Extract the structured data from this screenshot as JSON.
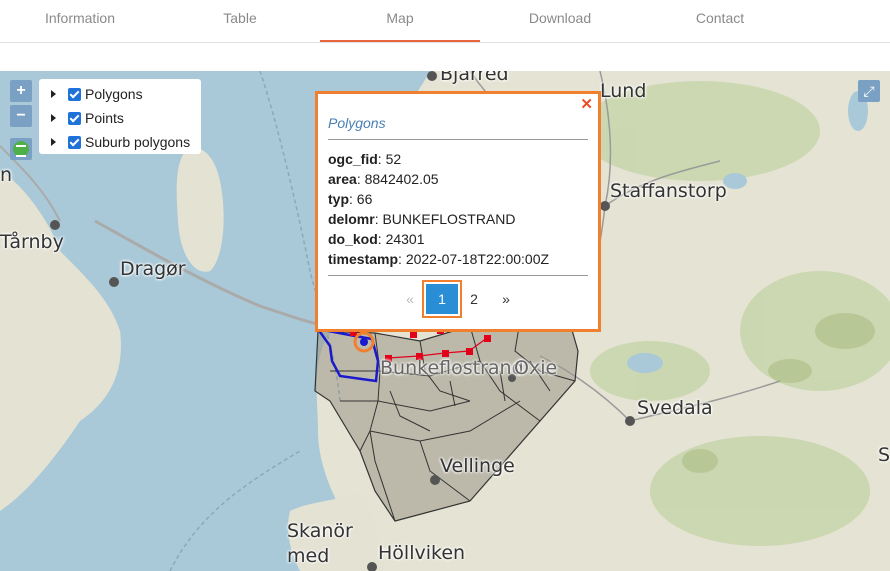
{
  "tabs": [
    "Information",
    "Table",
    "Map",
    "Download",
    "Contact"
  ],
  "active_tab": "Map",
  "map": {
    "places": [
      "Bjärred",
      "Lund",
      "Staffanstorp",
      "Tårnby",
      "Dragør",
      "Svedala",
      "Vellinge",
      "Bunkeflostrand",
      "Oxie",
      "Skanör",
      "med",
      "Höllviken",
      "n",
      "S"
    ],
    "zoom_in": "+",
    "zoom_out": "−",
    "fullscreen": "⤢"
  },
  "layers": [
    {
      "label": "Polygons",
      "checked": true
    },
    {
      "label": "Points",
      "checked": true
    },
    {
      "label": "Suburb polygons",
      "checked": true
    }
  ],
  "popup": {
    "title": "Polygons",
    "close": "✕",
    "fields": [
      {
        "key": "ogc_fid",
        "value": "52"
      },
      {
        "key": "area",
        "value": "8842402.05"
      },
      {
        "key": "typ",
        "value": "66"
      },
      {
        "key": "delomr",
        "value": "BUNKEFLOSTRAND"
      },
      {
        "key": "do_kod",
        "value": "24301"
      },
      {
        "key": "timestamp",
        "value": "2022-07-18T22:00:00Z"
      }
    ],
    "pager": {
      "prev": "«",
      "pages": [
        "1",
        "2"
      ],
      "current": "1",
      "next": "»"
    }
  },
  "colors": {
    "accent": "#e8663d",
    "water": "#a9c9d8",
    "land": "#e4e2d3",
    "polygon": "#8f8d80",
    "points": "#e3001b",
    "selected": "#1a1acc"
  }
}
